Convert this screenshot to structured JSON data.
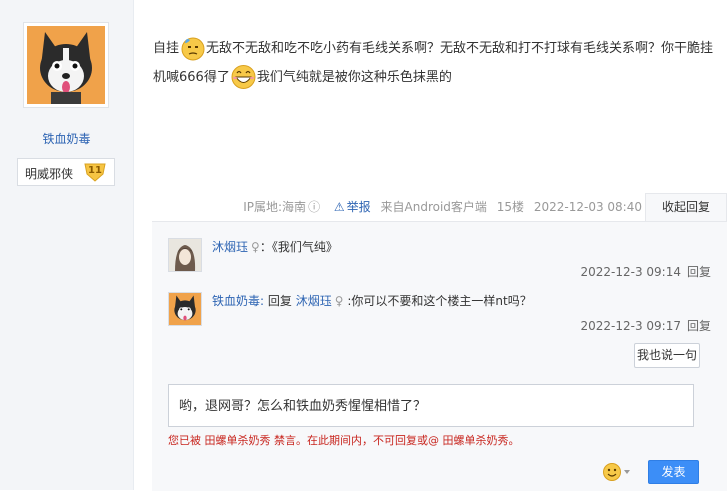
{
  "user": {
    "name": "铁血奶毒",
    "rank_name": "明威邪侠",
    "rank_level": "11"
  },
  "post": {
    "segment1": "自挂",
    "segment2": "无敌不无敌和吃不吃小药有毛线关系啊？无敌不无敌和打不打球有毛线关系啊？你干脆挂机喊666得了",
    "segment3": "我们气纯就是被你这种乐色抹黑的",
    "emoji_1": "sweat-face-emoji",
    "emoji_2": "grin-face-emoji"
  },
  "meta": {
    "ip": "IP属地:海南",
    "report": "举报",
    "client": "来自Android客户端",
    "floor": "15楼",
    "time": "2022-12-03 08:40",
    "collapse": "收起回复"
  },
  "replies": [
    {
      "user": "沐烟珏",
      "separator": "：",
      "content": "《我们气纯》",
      "time": "2022-12-3 09:14",
      "reply_label": "回复"
    },
    {
      "user": "铁血奶毒",
      "separator": ":",
      "reply_prefix": "回复",
      "target": "沐烟珏",
      "content": ":你可以不要和这个楼主一样nt吗？",
      "time": "2022-12-3 09:17",
      "reply_label": "回复"
    }
  ],
  "say_button": "我也说一句",
  "input_text": "哟，退网哥？怎么和铁血奶秀惺惺相惜了？",
  "ban_notice": "您已被 田螺单杀奶秀 禁言。在此期间内，不可回复或@ 田螺单杀奶秀。",
  "publish_button": "发表",
  "colors": {
    "link": "#2d64b3",
    "accent": "#3c8ef7",
    "warning": "#c8261f"
  }
}
